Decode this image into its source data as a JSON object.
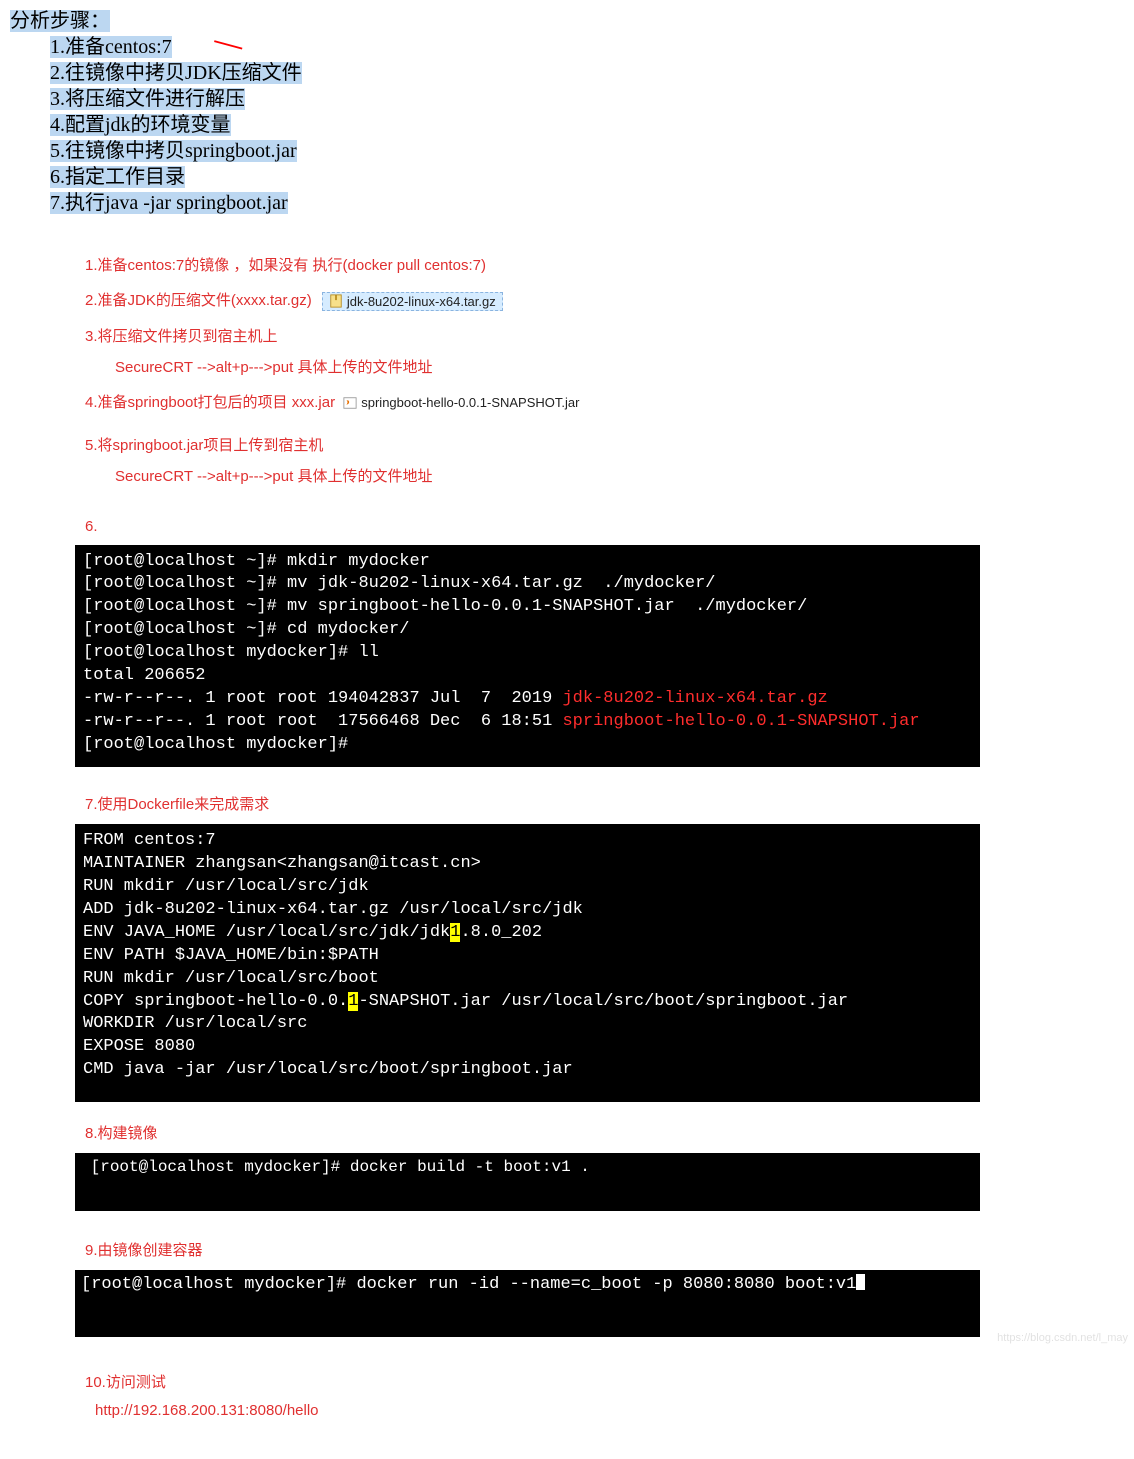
{
  "top": {
    "title": "分析步骤：",
    "steps": [
      "1.准备centos:7",
      "2.往镜像中拷贝JDK压缩文件",
      "3.将压缩文件进行解压",
      "4.配置jdk的环境变量",
      "5.往镜像中拷贝springboot.jar",
      "6.指定工作目录",
      "7.执行java -jar springboot.jar"
    ]
  },
  "annot_mark": "＼",
  "steps_red": {
    "s1": "1.准备centos:7的镜像 ，如果没有 执行(docker pull centos:7)",
    "s2": "2.准备JDK的压缩文件(xxxx.tar.gz)",
    "s2_file": "jdk-8u202-linux-x64.tar.gz",
    "s3": "3.将压缩文件拷贝到宿主机上",
    "s3_sub": "SecureCRT -->alt+p--->put  具体上传的文件地址",
    "s4": "4.准备springboot打包后的项目 xxx.jar",
    "s4_file": "springboot-hello-0.0.1-SNAPSHOT.jar",
    "s5": "5.将springboot.jar项目上传到宿主机",
    "s5_sub": "SecureCRT -->alt+p--->put  具体上传的文件地址",
    "s6": "6.",
    "s7": "7.使用Dockerfile来完成需求",
    "s8": "8.构建镜像",
    "s9": "9.由镜像创建容器",
    "s10": "10.访问测试",
    "s10_url": "http://192.168.200.131:8080/hello"
  },
  "term1": {
    "l1": "[root@localhost ~]# mkdir mydocker",
    "l2": "[root@localhost ~]# mv jdk-8u202-linux-x64.tar.gz  ./mydocker/",
    "l3": "[root@localhost ~]# mv springboot-hello-0.0.1-SNAPSHOT.jar  ./mydocker/",
    "l4": "[root@localhost ~]# cd mydocker/",
    "l5": "[root@localhost mydocker]# ll",
    "l6": "total 206652",
    "l7a": "-rw-r--r--. 1 root root 194042837 Jul  7  2019 ",
    "l7b": "jdk-8u202-linux-x64.tar.gz",
    "l8a": "-rw-r--r--. 1 root root  17566468 Dec  6 18:51 ",
    "l8b": "springboot-hello-0.0.1-SNAPSHOT.jar",
    "l9": "[root@localhost mydocker]#"
  },
  "term2": {
    "l1": "FROM centos:7",
    "l2": "MAINTAINER zhangsan<zhangsan@itcast.cn>",
    "l3": "RUN mkdir /usr/local/src/jdk",
    "l4": "ADD jdk-8u202-linux-x64.tar.gz /usr/local/src/jdk",
    "l5a": "ENV JAVA_HOME /usr/local/src/jdk/jdk",
    "l5m": "1",
    "l5b": ".8.0_202",
    "l6": "ENV PATH $JAVA_HOME/bin:$PATH",
    "l7": "RUN mkdir /usr/local/src/boot",
    "l8a": "COPY springboot-hello-0.0.",
    "l8m": "1",
    "l8b": "-SNAPSHOT.jar /usr/local/src/boot/springboot.jar",
    "l9": "WORKDIR /usr/local/src",
    "l10": "EXPOSE 8080",
    "l11": "CMD java -jar /usr/local/src/boot/springboot.jar"
  },
  "term3": {
    "l1": "[root@localhost mydocker]# docker build -t boot:v1 ."
  },
  "term4": {
    "l1": "[root@localhost mydocker]# docker run -id --name=c_boot -p 8080:8080 boot:v1"
  },
  "watermark": "https://blog.csdn.net/l_may"
}
